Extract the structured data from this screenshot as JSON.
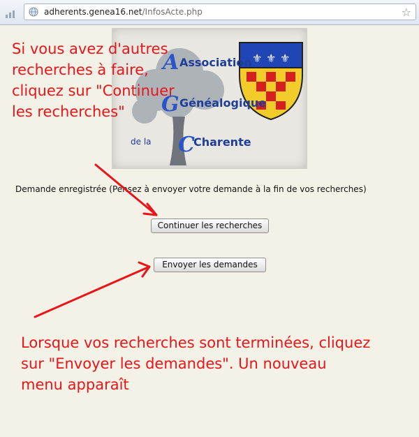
{
  "browser": {
    "url_host": "adherents.genea16.net",
    "url_path": "/InfosActe.php"
  },
  "logo": {
    "word1": "Association",
    "word2": "Généalogique",
    "word3": "de la",
    "word4": "Charente"
  },
  "page": {
    "status_message": "Demande enregistrée (Pensez à envoyer votre demande à la fin de vos recherches)",
    "continue_button": "Continuer les recherches",
    "send_button": "Envoyer les demandes"
  },
  "annotations": {
    "top_lines": [
      "Si vous avez d'autres",
      "recherches à faire,",
      "cliquez sur \"Continuer",
      "les recherches\""
    ],
    "bottom_lines": [
      "Lorsque vos recherches sont terminées, cliquez",
      "sur \"Envoyer les demandes\". Un nouveau",
      "menu apparaît"
    ],
    "color": "#e8161a"
  }
}
